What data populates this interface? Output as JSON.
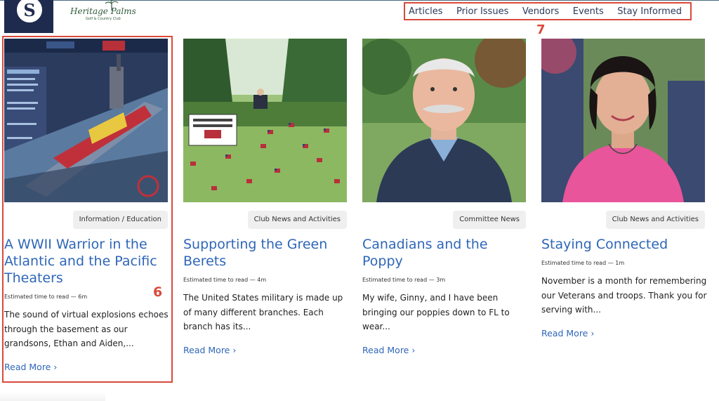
{
  "header": {
    "logo_letter": "S",
    "brand_name": "Heritage Palms",
    "brand_sub": "Golf & Country Club",
    "nav": [
      "Articles",
      "Prior Issues",
      "Vendors",
      "Events",
      "Stay Informed"
    ],
    "annotation_number": "7"
  },
  "cards": [
    {
      "category": "Information / Education",
      "title": "A WWII Warrior in the Atlantic and the Pacific Theaters",
      "read_time": "Estimated time to read — 6m",
      "excerpt": "The sound of virtual explosions echoes through the basement as our grandsons, Ethan and Aiden,...",
      "read_more": "Read More",
      "image": "warship-game-screenshot"
    },
    {
      "category": "Club News and Activities",
      "title": "Supporting the Green Berets",
      "read_time": "Estimated time to read — 4m",
      "excerpt": "The United States military is made up of many different branches. Each branch has its...",
      "read_more": "Read More",
      "image": "flags-on-lawn-photo"
    },
    {
      "category": "Committee News",
      "title": "Canadians and the Poppy",
      "read_time": "Estimated time to read — 3m",
      "excerpt": "My wife, Ginny, and I have been bringing our poppies down to FL to wear...",
      "read_more": "Read More",
      "image": "man-portrait-photo"
    },
    {
      "category": "Club News and Activities",
      "title": "Staying Connected",
      "read_time": "Estimated time to read — 1m",
      "excerpt": "November is a month for remembering our Veterans and troops. Thank you for serving with...",
      "read_more": "Read More",
      "image": "woman-portrait-photo"
    }
  ],
  "annotation_number": "6",
  "colors": {
    "accent": "#d94a3a",
    "link": "#2e66b8",
    "logo_bg": "#1f2b4e"
  }
}
